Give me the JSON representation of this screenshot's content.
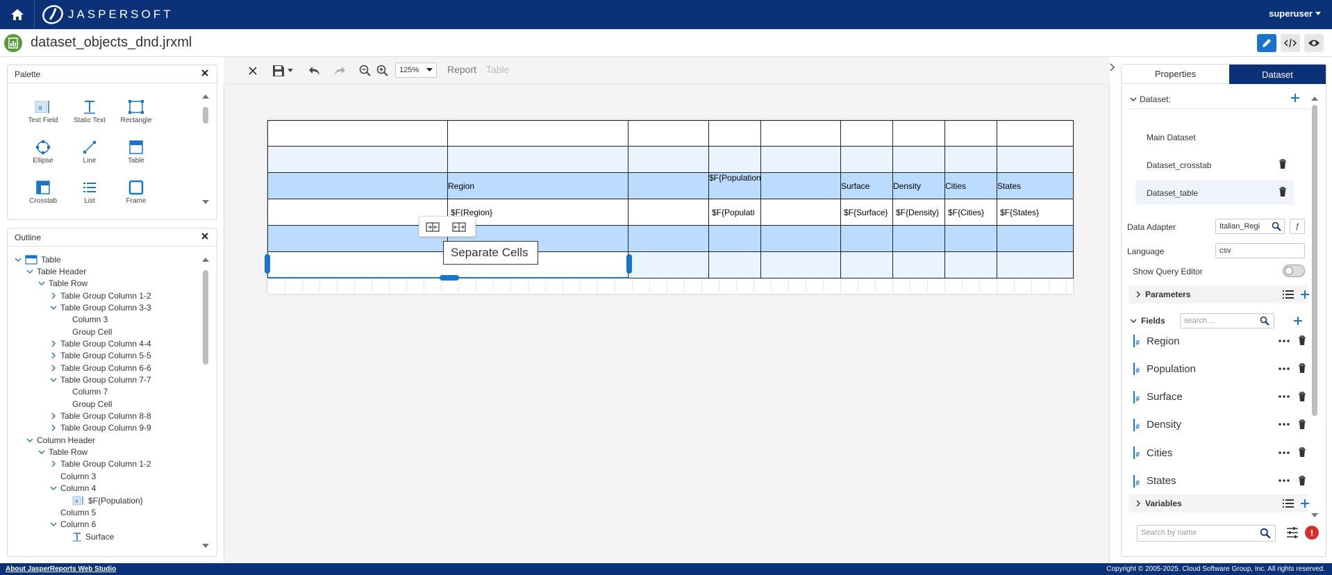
{
  "app": {
    "logo_text": "JASPERSOFT",
    "user": "superuser",
    "file_title": "dataset_objects_dnd.jrxml"
  },
  "palette": {
    "title": "Palette",
    "items": [
      {
        "label": "Text Field",
        "icon": "text-field-icon"
      },
      {
        "label": "Static Text",
        "icon": "static-text-icon"
      },
      {
        "label": "Rectangle",
        "icon": "rectangle-icon"
      },
      {
        "label": "Ellipse",
        "icon": "ellipse-icon"
      },
      {
        "label": "Line",
        "icon": "line-icon"
      },
      {
        "label": "Table",
        "icon": "table-icon"
      },
      {
        "label": "Crosstab",
        "icon": "crosstab-icon"
      },
      {
        "label": "List",
        "icon": "list-icon"
      },
      {
        "label": "Frame",
        "icon": "frame-icon"
      }
    ]
  },
  "outline": {
    "title": "Outline",
    "items": [
      {
        "label": "Table",
        "level": 0,
        "chevron": "down",
        "icon": "table"
      },
      {
        "label": "Table Header",
        "level": 1,
        "chevron": "down"
      },
      {
        "label": "Table Row",
        "level": 2,
        "chevron": "down"
      },
      {
        "label": "Table Group Column 1-2",
        "level": 3,
        "chevron": "right"
      },
      {
        "label": "Table Group Column 3-3",
        "level": 3,
        "chevron": "down"
      },
      {
        "label": "Column 3",
        "level": 4,
        "chevron": ""
      },
      {
        "label": "Group Cell",
        "level": 4,
        "chevron": ""
      },
      {
        "label": "Table Group Column 4-4",
        "level": 3,
        "chevron": "right"
      },
      {
        "label": "Table Group Column 5-5",
        "level": 3,
        "chevron": "right"
      },
      {
        "label": "Table Group Column 6-6",
        "level": 3,
        "chevron": "right"
      },
      {
        "label": "Table Group Column 7-7",
        "level": 3,
        "chevron": "down"
      },
      {
        "label": "Column 7",
        "level": 4,
        "chevron": ""
      },
      {
        "label": "Group Cell",
        "level": 4,
        "chevron": ""
      },
      {
        "label": "Table Group Column 8-8",
        "level": 3,
        "chevron": "right"
      },
      {
        "label": "Table Group Column 9-9",
        "level": 3,
        "chevron": "right"
      },
      {
        "label": "Column Header",
        "level": 1,
        "chevron": "down"
      },
      {
        "label": "Table Row",
        "level": 2,
        "chevron": "down"
      },
      {
        "label": "Table Group Column 1-2",
        "level": 3,
        "chevron": "right"
      },
      {
        "label": "Column 3",
        "level": 3,
        "chevron": ""
      },
      {
        "label": "Column 4",
        "level": 3,
        "chevron": "down"
      },
      {
        "label": "$F{Population}",
        "level": 4,
        "chevron": "",
        "icon": "textfield"
      },
      {
        "label": "Column 5",
        "level": 3,
        "chevron": ""
      },
      {
        "label": "Column 6",
        "level": 3,
        "chevron": "down"
      },
      {
        "label": "Surface",
        "level": 4,
        "chevron": "",
        "icon": "statictext"
      }
    ]
  },
  "toolbar": {
    "zoom": "125%",
    "crumb_report": "Report",
    "crumb_table": "Table"
  },
  "report": {
    "header_cells": [
      "Region",
      "$F{Population",
      "Surface",
      "Density",
      "Cities",
      "States"
    ],
    "detail_cells": [
      "$F{Region}",
      "$F{Populati",
      "$F{Surface}",
      "$F{Density}",
      "$F{Cities}",
      "$F{States}"
    ],
    "tooltip": "Separate Cells"
  },
  "dataset_panel": {
    "tab_properties": "Properties",
    "tab_dataset": "Dataset",
    "dataset_label": "Dataset:",
    "datasets": [
      {
        "name": "Main Dataset",
        "deletable": false,
        "selected": false
      },
      {
        "name": "Dataset_crosstab",
        "deletable": true,
        "selected": false
      },
      {
        "name": "Dataset_table",
        "deletable": true,
        "selected": true
      }
    ],
    "data_adapter_label": "Data Adapter",
    "data_adapter_value": "Italian_Regi",
    "language_label": "Language",
    "language_value": "csv",
    "show_query_label": "Show Query Editor",
    "parameters_label": "Parameters",
    "fields_label": "Fields",
    "fields_search_placeholder": "search ...",
    "fields": [
      "Region",
      "Population",
      "Surface",
      "Density",
      "Cities",
      "States"
    ],
    "variables_label": "Variables",
    "search_placeholder": "Search by name"
  },
  "footer": {
    "left": "About JasperReports Web Studio",
    "right": "Copyright © 2005-2025. Cloud Software Group, Inc. All rights reserved."
  },
  "colors": {
    "brand_navy": "#0b3179",
    "accent_blue": "#1a74c9",
    "band_blue": "#bcdcff",
    "band_light": "#eaf4ff",
    "error_red": "#d32f2f"
  }
}
